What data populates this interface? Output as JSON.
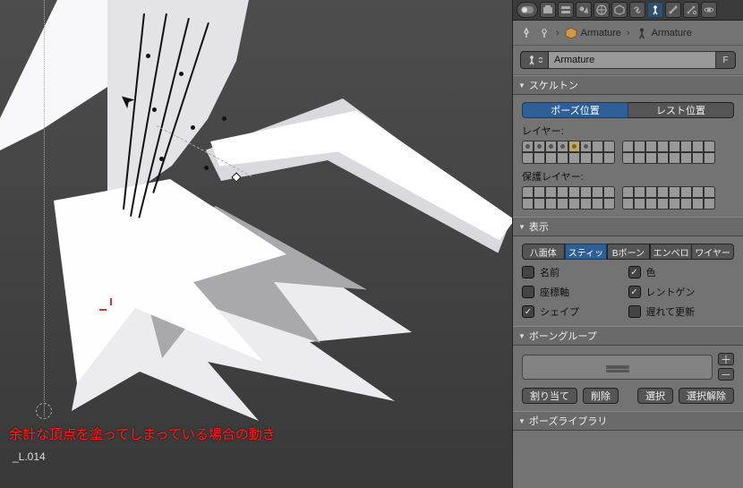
{
  "breadcrumb": {
    "root_icon": "cube",
    "root": "Armature",
    "leaf_icon": "armature",
    "leaf": "Armature"
  },
  "datablock": {
    "name": "Armature",
    "fake_user": "F"
  },
  "skeleton": {
    "header": "スケルトン",
    "tab_pose": "ポーズ位置",
    "tab_rest": "レスト位置",
    "layers_label": "レイヤー:",
    "protected_layers_label": "保護レイヤー:"
  },
  "display": {
    "header": "表示",
    "shape_tabs": {
      "octa": "八面体",
      "stick": "スティッ",
      "bbone": "Bボーン",
      "envelope": "エンベロ",
      "wire": "ワイヤー"
    },
    "checks": {
      "names": "名前",
      "axes": "座標軸",
      "shapes": "シェイプ",
      "colors": "色",
      "xray": "レントゲン",
      "delay": "遅れて更新"
    }
  },
  "bone_groups": {
    "header": "ボーングループ",
    "assign": "割り当て",
    "remove": "削除",
    "select": "選択",
    "deselect": "選択解除"
  },
  "pose_library": {
    "header": "ポーズライブラリ"
  },
  "viewport": {
    "caption": "余計な頂点を塗ってしまっている場合の動き",
    "active_bone": "_L.014"
  }
}
